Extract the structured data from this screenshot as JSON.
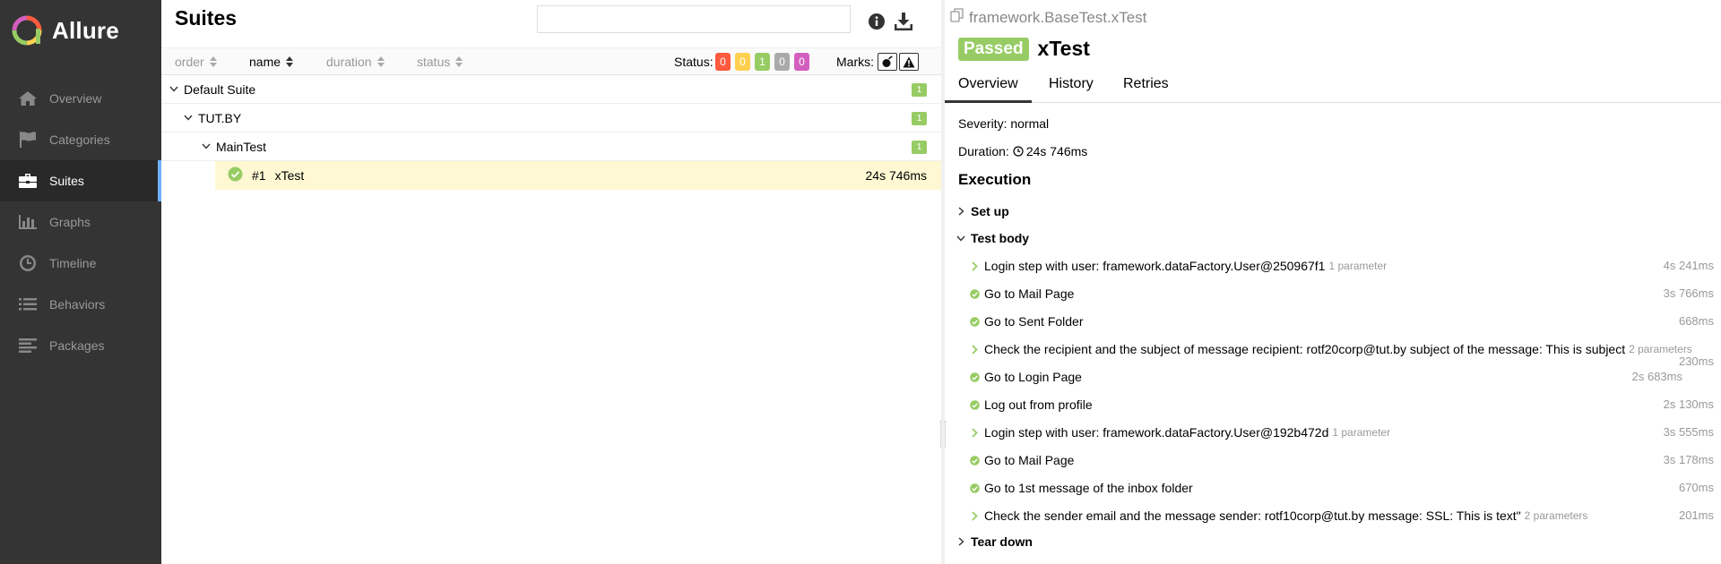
{
  "sidebar": {
    "brand": "Allure",
    "items": [
      {
        "label": "Overview",
        "icon": "home-icon"
      },
      {
        "label": "Categories",
        "icon": "flag-icon"
      },
      {
        "label": "Suites",
        "icon": "briefcase-icon"
      },
      {
        "label": "Graphs",
        "icon": "bar-chart-icon"
      },
      {
        "label": "Timeline",
        "icon": "clock-icon"
      },
      {
        "label": "Behaviors",
        "icon": "list-icon"
      },
      {
        "label": "Packages",
        "icon": "align-left-icon"
      }
    ],
    "active": "Suites"
  },
  "suites": {
    "title": "Suites",
    "search_value": "",
    "sort": {
      "order": "order",
      "name": "name",
      "duration": "duration",
      "status": "status",
      "active": "name"
    },
    "status_label": "Status:",
    "status_counts": [
      {
        "name": "failed",
        "value": "0",
        "color": "#fd5a3e"
      },
      {
        "name": "broken",
        "value": "0",
        "color": "#ffd050"
      },
      {
        "name": "passed",
        "value": "1",
        "color": "#97cc64"
      },
      {
        "name": "skipped",
        "value": "0",
        "color": "#aaaaaa"
      },
      {
        "name": "unknown",
        "value": "0",
        "color": "#d35ebe"
      }
    ],
    "marks_label": "Marks:",
    "tree": {
      "suite": {
        "name": "Default Suite",
        "count": "1"
      },
      "group": {
        "name": "TUT.BY",
        "count": "1"
      },
      "class": {
        "name": "MainTest",
        "count": "1"
      },
      "test": {
        "num": "#1",
        "name": "xTest",
        "duration": "24s 746ms"
      }
    }
  },
  "result": {
    "breadcrumb": "framework.BaseTest.xTest",
    "status": "Passed",
    "title": "xTest",
    "tabs": [
      "Overview",
      "History",
      "Retries"
    ],
    "severity": "Severity: normal",
    "duration_label": "Duration:",
    "duration": "24s 746ms",
    "execution_title": "Execution",
    "setup": "Set up",
    "body": "Test body",
    "teardown": "Tear down",
    "steps": [
      {
        "type": "expand",
        "name": "Login step with user: framework.dataFactory.User@250967f1",
        "params": "1 parameter",
        "duration": "4s 241ms"
      },
      {
        "type": "passed",
        "name": "Go to Mail Page",
        "params": "",
        "duration": "3s 766ms"
      },
      {
        "type": "passed",
        "name": "Go to Sent Folder",
        "params": "",
        "duration": "668ms"
      },
      {
        "type": "expand",
        "name": "Check the recipient and the subject of message recipient: rotf20corp@tut.by subject of the message: This is subject",
        "params": "2 parameters",
        "duration": "230ms"
      },
      {
        "type": "passed",
        "name": "Go to Login Page",
        "params": "",
        "duration": "2s 683ms"
      },
      {
        "type": "passed",
        "name": "Log out from profile",
        "params": "",
        "duration": "2s 130ms"
      },
      {
        "type": "expand",
        "name": "Login step with user: framework.dataFactory.User@192b472d",
        "params": "1 parameter",
        "duration": "3s 555ms"
      },
      {
        "type": "passed",
        "name": "Go to Mail Page",
        "params": "",
        "duration": "3s 178ms"
      },
      {
        "type": "passed",
        "name": "Go to 1st message of the inbox folder",
        "params": "",
        "duration": "670ms"
      },
      {
        "type": "expand",
        "name": "Check the sender email and the message sender: rotf10corp@tut.by message: SSL: This is text\"",
        "params": "2 parameters",
        "duration": "201ms"
      }
    ]
  },
  "colors": {
    "sidebar": "#343434",
    "passed": "#97cc64",
    "highlight": "#fff8d2",
    "active_marker": "#6eb0ff"
  }
}
